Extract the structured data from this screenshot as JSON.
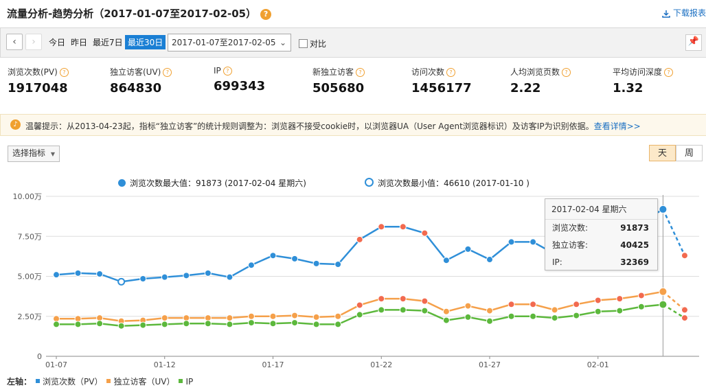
{
  "header": {
    "title": "流量分析-趋势分析（2017-01-07至2017-02-05）",
    "help": "?",
    "download": "下载报表"
  },
  "toolbar": {
    "prev": "‹",
    "next": "›",
    "ranges": [
      "今日",
      "昨日",
      "最近7日",
      "最近30日"
    ],
    "active_range": "最近30日",
    "date_value": "2017-01-07至2017-02-05",
    "compare_label": "对比"
  },
  "metrics": [
    {
      "label": "浏览次数(PV)",
      "value": "1917048"
    },
    {
      "label": "独立访客(UV)",
      "value": "864830"
    },
    {
      "label": "IP",
      "value": "699343"
    },
    {
      "label": "新独立访客",
      "value": "505680"
    },
    {
      "label": "访问次数",
      "value": "1456177"
    },
    {
      "label": "人均浏览页数",
      "value": "2.22"
    },
    {
      "label": "平均访问深度",
      "value": "1.32"
    }
  ],
  "notice": {
    "text": "温馨提示：从2013-04-23起，指标“独立访客”的统计规则调整为：浏览器不接受cookie时，以浏览器UA（User Agent浏览器标识）及访客IP为识别依据。",
    "link": "查看详情>>"
  },
  "controls": {
    "metric_select": "选择指标",
    "day": "天",
    "week": "周"
  },
  "legend_top": {
    "max": "浏览次数最大值：91873 (2017-02-04 星期六)",
    "min": "浏览次数最小值：46610 (2017-01-10 )"
  },
  "tooltip": {
    "date": "2017-02-04 星期六",
    "rows": [
      {
        "label": "浏览次数:",
        "value": "91873"
      },
      {
        "label": "独立访客:",
        "value": "40425"
      },
      {
        "label": "IP:",
        "value": "32369"
      }
    ]
  },
  "bottom_legend": {
    "prefix": "左轴：",
    "items": [
      "浏览次数（PV）",
      "独立访客（UV）",
      "IP"
    ]
  },
  "colors": {
    "pv": "#2f8fd8",
    "uv": "#f5a04a",
    "ip": "#5cb83c",
    "hot": "#f26a4f",
    "accent": "#1a7fd4"
  },
  "chart_data": {
    "type": "line",
    "x": [
      "01-07",
      "01-08",
      "01-09",
      "01-10",
      "01-11",
      "01-12",
      "01-13",
      "01-14",
      "01-15",
      "01-16",
      "01-17",
      "01-18",
      "01-19",
      "01-20",
      "01-21",
      "01-22",
      "01-23",
      "01-24",
      "01-25",
      "01-26",
      "01-27",
      "01-28",
      "01-29",
      "01-30",
      "01-31",
      "02-01",
      "02-02",
      "02-03",
      "02-04",
      "02-05"
    ],
    "xticks": [
      "01-07",
      "01-12",
      "01-17",
      "01-22",
      "01-27",
      "02-01"
    ],
    "yticks": [
      "0",
      "2.50万",
      "5.00万",
      "7.50万",
      "10.00万"
    ],
    "ylim": [
      0,
      100000
    ],
    "series": [
      {
        "name": "浏览次数（PV）",
        "values": [
          51000,
          52000,
          51500,
          46610,
          48500,
          49500,
          50500,
          52000,
          49500,
          57000,
          63000,
          61000,
          58000,
          57500,
          73000,
          81000,
          81000,
          77000,
          60000,
          67000,
          60500,
          71500,
          71500,
          64000,
          75000,
          77500,
          78500,
          84000,
          91873,
          63000
        ]
      },
      {
        "name": "独立访客（UV）",
        "values": [
          23500,
          23500,
          24000,
          22000,
          22500,
          24000,
          24000,
          24000,
          24000,
          25000,
          25000,
          25500,
          24500,
          25000,
          32000,
          36000,
          36000,
          34500,
          28000,
          31500,
          28500,
          32500,
          32500,
          29000,
          32500,
          35000,
          36000,
          38000,
          40425,
          29000
        ]
      },
      {
        "name": "IP",
        "values": [
          20000,
          20000,
          20500,
          19000,
          19500,
          20000,
          20500,
          20500,
          20000,
          21000,
          20500,
          21000,
          20000,
          20000,
          26000,
          29000,
          29000,
          28500,
          22500,
          24500,
          22000,
          25000,
          25000,
          24000,
          25500,
          28000,
          28500,
          31000,
          32369,
          24000
        ]
      }
    ]
  }
}
